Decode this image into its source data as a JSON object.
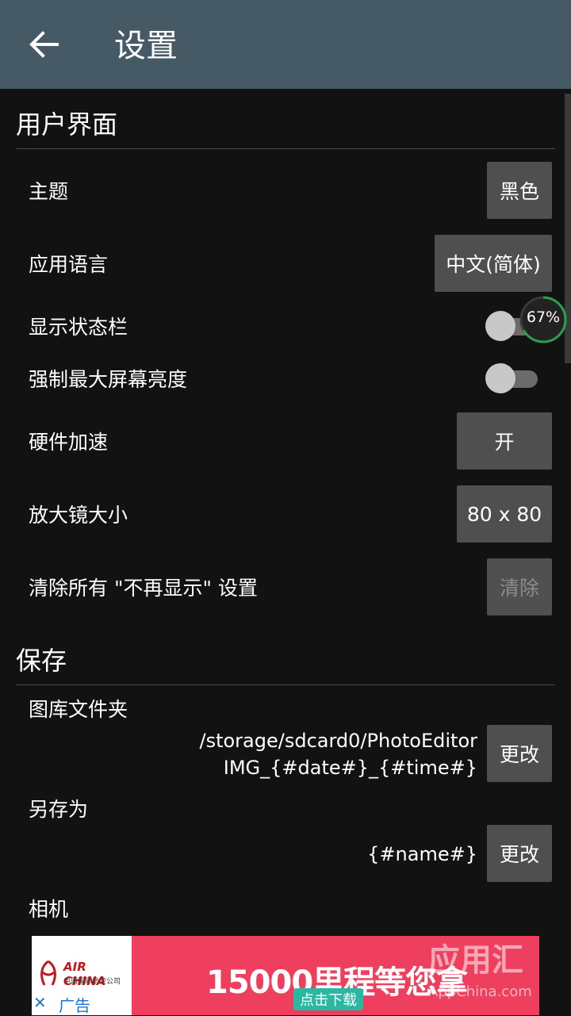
{
  "appbar": {
    "title": "设置",
    "back_icon": "arrow-left-icon"
  },
  "ui_section": {
    "header": "用户界面",
    "theme": {
      "label": "主题",
      "value": "黑色"
    },
    "language": {
      "label": "应用语言",
      "value": "中文(简体)"
    },
    "show_status_bar": {
      "label": "显示状态栏",
      "enabled": false
    },
    "force_max_brightness": {
      "label": "强制最大屏幕亮度",
      "enabled": false
    },
    "hardware_acceleration": {
      "label": "硬件加速",
      "value": "开"
    },
    "magnifier_size": {
      "label": "放大镜大小",
      "value": "80 x 80"
    },
    "clear_dont_show": {
      "label": "清除所有 \"不再显示\" 设置",
      "button": "清除"
    }
  },
  "save_section": {
    "header": "保存",
    "gallery_folder": {
      "label": "图库文件夹",
      "path": "/storage/sdcard0/PhotoEditor",
      "filename": "IMG_{#date#}_{#time#}",
      "button": "更改"
    },
    "save_as": {
      "label": "另存为",
      "value": "{#name#}",
      "button": "更改"
    },
    "camera": {
      "label": "相机"
    }
  },
  "overlay": {
    "progress": "67%",
    "progress_value": 0.67
  },
  "ad": {
    "brand": "AIR CHINA",
    "brand_cn": "中国国际航空公司",
    "close_icon": "close-icon",
    "tag": "广告",
    "headline": "15000里程等您拿",
    "cta": "点击下载"
  },
  "watermark": {
    "text": "应用汇",
    "url": "AppChina.com"
  },
  "colors": {
    "appbar": "#455a64",
    "background": "#121212",
    "button": "#4f4f4f",
    "ad": "#ee3f5e"
  }
}
